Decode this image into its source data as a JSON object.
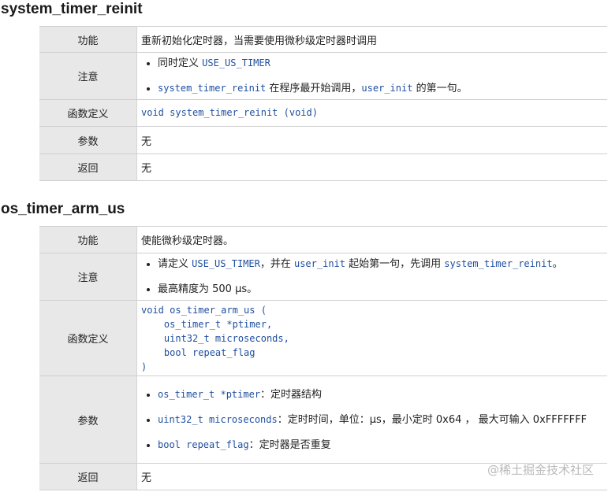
{
  "section1": {
    "title": "system_timer_reinit",
    "function_key": "功能",
    "function_val": "重新初始化定时器，当需要使用微秒级定时器时调用",
    "note_key": "注意",
    "note1_pre": "同时定义 ",
    "note1_code": "USE_US_TIMER",
    "note2_code1": "system_timer_reinit",
    "note2_mid": " 在程序最开始调用，",
    "note2_code2": "user_init",
    "note2_post": " 的第一句。",
    "def_key": "函数定义",
    "def_val": "void system_timer_reinit (void)",
    "param_key": "参数",
    "param_val": "无",
    "return_key": "返回",
    "return_val": "无"
  },
  "section2": {
    "title": "os_timer_arm_us",
    "function_key": "功能",
    "function_val": "使能微秒级定时器。",
    "note_key": "注意",
    "note1_pre": "请定义 ",
    "note1_code1": "USE_US_TIMER",
    "note1_mid1": "，并在 ",
    "note1_code2": "user_init",
    "note1_mid2": " 起始第一句，先调用 ",
    "note1_code3": "system_timer_reinit",
    "note1_post": "。",
    "note2": "最高精度为 500 μs。",
    "def_key": "函数定义",
    "def_val": "void os_timer_arm_us (\n    os_timer_t *ptimer,\n    uint32_t microseconds,\n    bool repeat_flag\n)",
    "param_key": "参数",
    "param1_code": "os_timer_t *ptimer",
    "param1_text": "：定时器结构",
    "param2_code": "uint32_t microseconds",
    "param2_text": "：定时时间，单位：μs，最小定时 0x64 ， 最大可输入 0xFFFFFFF",
    "param3_code": "bool repeat_flag",
    "param3_text": "：定时器是否重复",
    "return_key": "返回",
    "return_val": "无"
  },
  "watermark": "@稀土掘金技术社区"
}
